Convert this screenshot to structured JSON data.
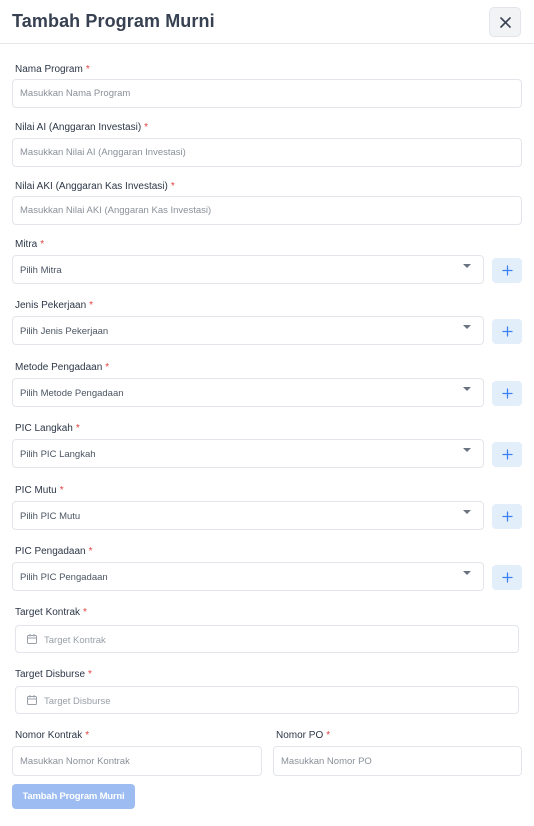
{
  "modal": {
    "title": "Tambah Program Murni"
  },
  "required_mark": "*",
  "fields": {
    "nama_program": {
      "label": "Nama Program",
      "placeholder": "Masukkan Nama Program",
      "value": ""
    },
    "nilai_ai": {
      "label": "Nilai AI (Anggaran Investasi)",
      "placeholder": "Masukkan Nilai AI (Anggaran Investasi)",
      "value": ""
    },
    "nilai_aki": {
      "label": "Nilai AKI (Anggaran Kas Investasi)",
      "placeholder": "Masukkan Nilai AKI (Anggaran Kas Investasi)",
      "value": ""
    },
    "mitra": {
      "label": "Mitra",
      "selected": "Pilih Mitra"
    },
    "jenis_pekerjaan": {
      "label": "Jenis Pekerjaan",
      "selected": "Pilih Jenis Pekerjaan"
    },
    "metode_pengadaan": {
      "label": "Metode Pengadaan",
      "selected": "Pilih Metode Pengadaan"
    },
    "pic_langkah": {
      "label": "PIC Langkah",
      "selected": "Pilih PIC Langkah"
    },
    "pic_mutu": {
      "label": "PIC Mutu",
      "selected": "Pilih PIC Mutu"
    },
    "pic_pengadaan": {
      "label": "PIC Pengadaan",
      "selected": "Pilih PIC Pengadaan"
    },
    "target_kontrak": {
      "label": "Target Kontrak",
      "placeholder": "Target Kontrak"
    },
    "target_disburse": {
      "label": "Target Disburse",
      "placeholder": "Target Disburse"
    },
    "nomor_kontrak": {
      "label": "Nomor Kontrak",
      "placeholder": "Masukkan Nomor Kontrak",
      "value": ""
    },
    "nomor_po": {
      "label": "Nomor PO",
      "placeholder": "Masukkan Nomor PO",
      "value": ""
    }
  },
  "submit_label": "Tambah Program Murni",
  "colors": {
    "required": "#e53e3e",
    "submit_bg": "#9cbcf2",
    "add_button_bg": "#e3eefb",
    "add_icon": "#3b82f6"
  },
  "icons": {
    "close": "close-icon",
    "add": "plus-icon",
    "caret": "caret-down-icon",
    "calendar": "calendar-icon"
  }
}
